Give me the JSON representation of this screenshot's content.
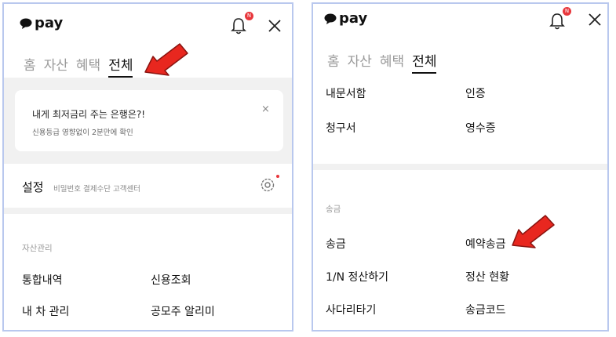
{
  "left_panel": {
    "logo_text": "pay",
    "badge": "N",
    "tabs": [
      {
        "label": "홈",
        "active": false
      },
      {
        "label": "자산",
        "active": false
      },
      {
        "label": "혜택",
        "active": false
      },
      {
        "label": "전체",
        "active": true
      }
    ],
    "banner": {
      "title": "내게 최저금리 주는 은행은?!",
      "subtitle": "신용등급 영향없이 2분만에 확인",
      "close": "×"
    },
    "settings": {
      "title": "설정",
      "subtitle": "비밀번호 결제수단 고객센터"
    },
    "asset_section": {
      "label": "자산관리",
      "items": [
        "통합내역",
        "신용조회",
        "내 차 관리",
        "공모주 알리미"
      ]
    }
  },
  "right_panel": {
    "logo_text": "pay",
    "badge": "N",
    "tabs": [
      {
        "label": "홈",
        "active": false
      },
      {
        "label": "자산",
        "active": false
      },
      {
        "label": "혜택",
        "active": false
      },
      {
        "label": "전체",
        "active": true
      }
    ],
    "top_items": [
      "내문서함",
      "인증",
      "청구서",
      "영수증"
    ],
    "transfer_section": {
      "label": "송금",
      "items": [
        "송금",
        "예약송금",
        "1/N 정산하기",
        "정산 현황",
        "사다리타기",
        "송금코드"
      ]
    }
  },
  "colors": {
    "accent_red": "#e8373c",
    "panel_border": "#b9c8ee",
    "arrow": "#e8271f"
  }
}
